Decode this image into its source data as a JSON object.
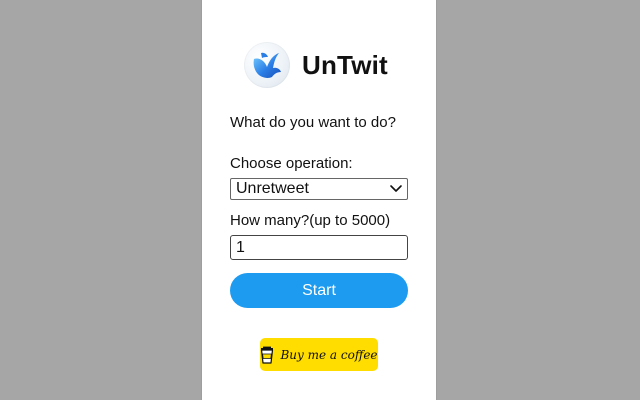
{
  "app": {
    "name": "UnTwit"
  },
  "form": {
    "question": "What do you want to do?",
    "operation_label": "Choose operation:",
    "operation_value": "Unretweet",
    "count_label": "How many?(up to 5000)",
    "count_value": "1",
    "start_label": "Start"
  },
  "coffee": {
    "label": "Buy me a coffee"
  },
  "colors": {
    "background": "#a6a6a6",
    "accent": "#1d9bf0",
    "coffee": "#ffdd00"
  },
  "icons": {
    "logo": "bird-logo-icon",
    "select": "chevron-down-icon",
    "coffee": "coffee-cup-icon"
  }
}
